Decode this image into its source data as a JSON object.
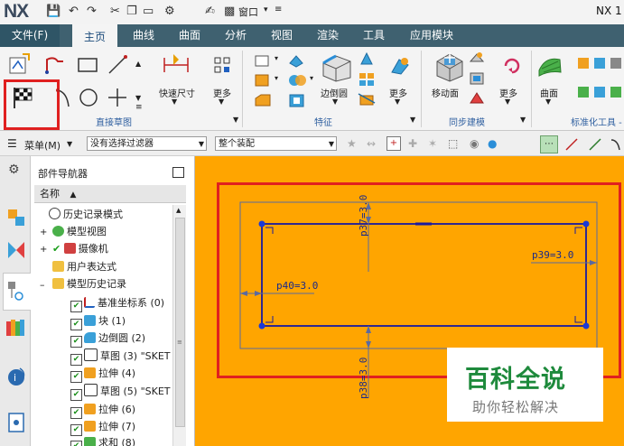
{
  "app": {
    "logo": "NX",
    "title": "NX 1"
  },
  "quick_access": {
    "window_label": "窗口"
  },
  "tabs": [
    {
      "label": "文件(F)"
    },
    {
      "label": "主页"
    },
    {
      "label": "曲线"
    },
    {
      "label": "曲面"
    },
    {
      "label": "分析"
    },
    {
      "label": "视图"
    },
    {
      "label": "渲染"
    },
    {
      "label": "工具"
    },
    {
      "label": "应用模块"
    }
  ],
  "ribbon": {
    "buttons": {
      "quick_dimension": "快速尺寸",
      "more1": "更多",
      "edge_blend": "边倒圆",
      "more2": "更多",
      "move_face": "移动面",
      "more3": "更多",
      "surface": "曲面"
    },
    "groups": {
      "direct_sketch": "直接草图",
      "feature": "特征",
      "sync_modeling": "同步建模",
      "standard_tools": "标准化工具 -"
    }
  },
  "selection_bar": {
    "menu_label": "菜单(M)",
    "filter_value": "没有选择过滤器",
    "scope_value": "整个装配"
  },
  "navigator": {
    "title": "部件导航器",
    "column_header": "名称",
    "items": [
      {
        "label": "历史记录模式"
      },
      {
        "label": "模型视图"
      },
      {
        "label": "摄像机"
      },
      {
        "label": "用户表达式"
      },
      {
        "label": "模型历史记录"
      },
      {
        "label": "基准坐标系 (0)"
      },
      {
        "label": "块 (1)"
      },
      {
        "label": "边倒圆 (2)"
      },
      {
        "label": "草图 (3) \"SKET"
      },
      {
        "label": "拉伸 (4)"
      },
      {
        "label": "草图 (5) \"SKET"
      },
      {
        "label": "拉伸 (6)"
      },
      {
        "label": "拉伸 (7)"
      },
      {
        "label": "求和 (8)"
      }
    ]
  },
  "sketch": {
    "dim_top": "p37=3.0",
    "dim_left": "p40=3.0",
    "dim_right": "p39=3.0",
    "dim_bottom": "p38=3.0"
  },
  "watermark": {
    "title": "百科全说",
    "subtitle": "助你轻松解决"
  },
  "colors": {
    "canvas": "#ffa500",
    "ribbon_tab_bar": "#3f6170",
    "highlight": "#e02020",
    "sketch_line": "#1a1aa0"
  }
}
